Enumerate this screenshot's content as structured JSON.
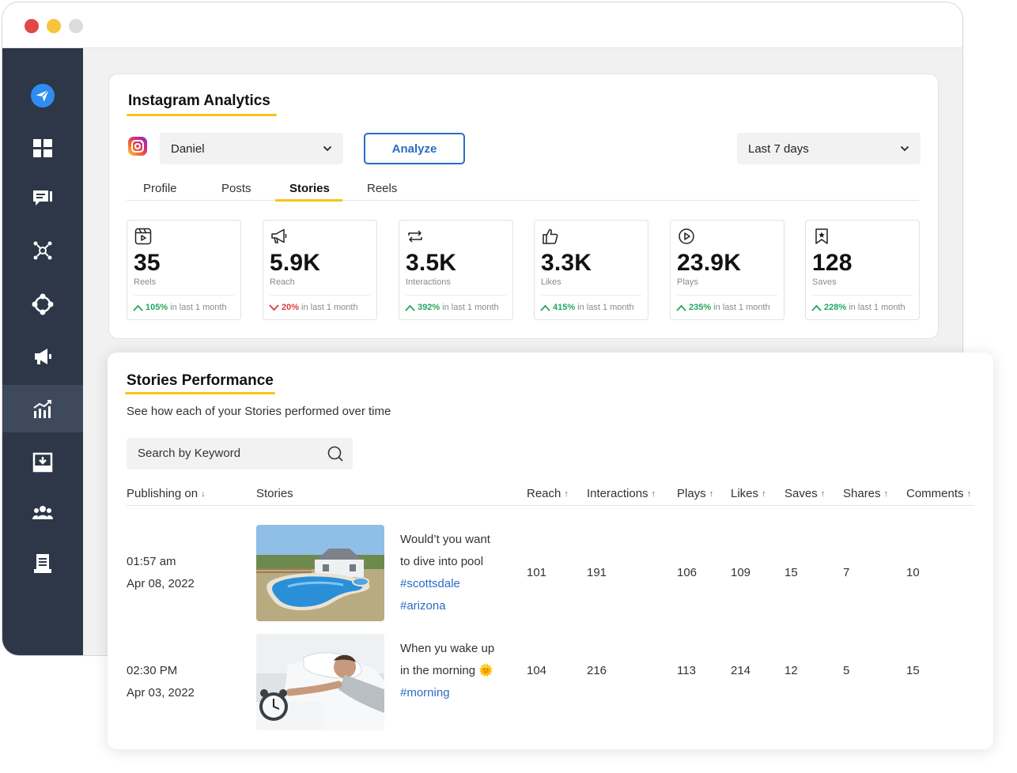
{
  "analytics": {
    "title": "Instagram Analytics",
    "account_select": "Daniel",
    "analyze_button": "Analyze",
    "range_select": "Last 7 days",
    "tabs": [
      {
        "label": "Profile"
      },
      {
        "label": "Posts"
      },
      {
        "label": "Stories"
      },
      {
        "label": "Reels"
      }
    ],
    "active_tab": "Stories",
    "stats": [
      {
        "icon": "reels-icon",
        "value": "35",
        "label": "Reels",
        "change": "105%",
        "direction": "up",
        "suffix": "in last 1 month"
      },
      {
        "icon": "megaphone-icon",
        "value": "5.9K",
        "label": "Reach",
        "change": "20%",
        "direction": "down",
        "suffix": "in last 1 month"
      },
      {
        "icon": "repeat-icon",
        "value": "3.5K",
        "label": "Interactions",
        "change": "392%",
        "direction": "up",
        "suffix": "in last 1 month"
      },
      {
        "icon": "thumbs-up-icon",
        "value": "3.3K",
        "label": "Likes",
        "change": "415%",
        "direction": "up",
        "suffix": "in last 1 month"
      },
      {
        "icon": "play-circle-icon",
        "value": "23.9K",
        "label": "Plays",
        "change": "235%",
        "direction": "up",
        "suffix": "in last 1 month"
      },
      {
        "icon": "bookmark-star-icon",
        "value": "128",
        "label": "Saves",
        "change": "228%",
        "direction": "up",
        "suffix": "in last 1 month"
      }
    ]
  },
  "stories": {
    "title": "Stories Performance",
    "subtitle": "See how each of your Stories performed over time",
    "search_placeholder": "Search by Keyword",
    "columns": [
      "Publishing on",
      "Stories",
      "Reach",
      "Interactions",
      "Plays",
      "Likes",
      "Saves",
      "Shares",
      "Comments"
    ],
    "rows": [
      {
        "time": "01:57 am",
        "date": "Apr 08, 2022",
        "caption_lines": [
          "Would’t you want",
          "to dive into pool"
        ],
        "hashtags": [
          "#scottsdale",
          "#arizona"
        ],
        "reach": "101",
        "interactions": "191",
        "plays": "106",
        "likes": "109",
        "saves": "15",
        "shares": "7",
        "comments": "10"
      },
      {
        "time": "02:30 PM",
        "date": "Apr 03, 2022",
        "caption_lines": [
          "When yu wake up",
          "in the morning 🌞"
        ],
        "hashtags": [
          "#morning"
        ],
        "reach": "104",
        "interactions": "216",
        "plays": "113",
        "likes": "214",
        "saves": "12",
        "shares": "5",
        "comments": "15"
      }
    ]
  },
  "colors": {
    "sidebar": "#2d3747",
    "accent_yellow": "#f5c518",
    "link_blue": "#2b6cc4",
    "positive": "#22a860",
    "negative": "#e03c3c"
  }
}
